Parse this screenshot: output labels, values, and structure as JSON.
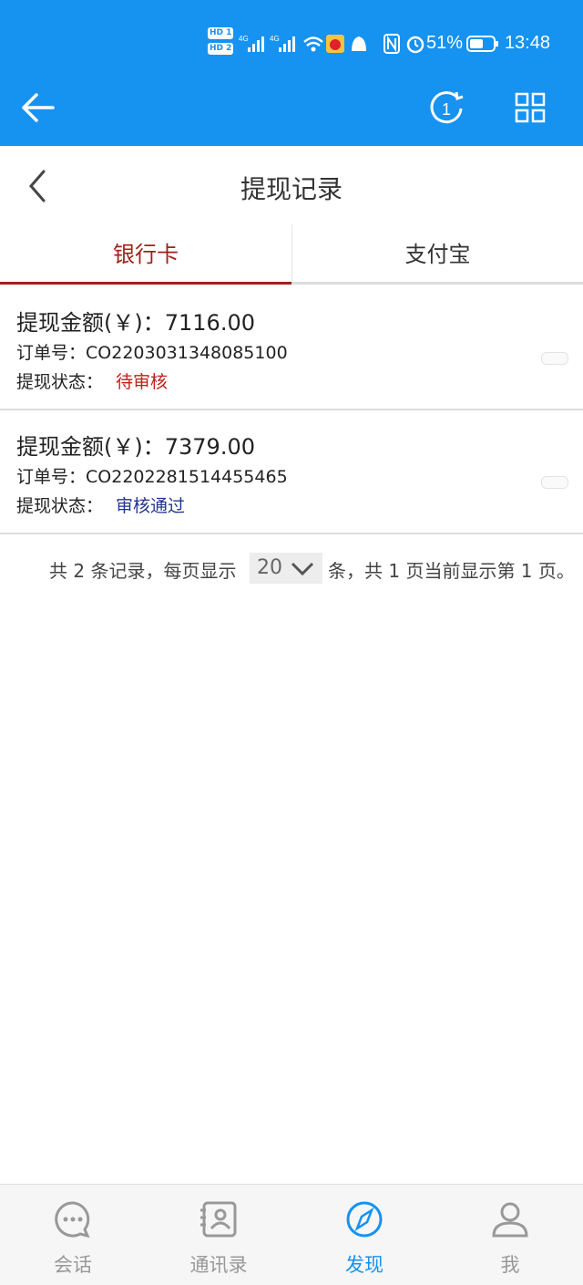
{
  "status_bar": {
    "time": "13:48",
    "battery": "51%",
    "hd1": "HD 1",
    "hd2": "HD 2",
    "net1": "4G",
    "net2": "4G",
    "icons": [
      "signal-icon",
      "wifi-icon",
      "weibo-icon",
      "qq-icon",
      "nfc-icon",
      "alarm-icon",
      "battery-icon"
    ]
  },
  "top_nav": {
    "ops_badge": "1",
    "icons": [
      "back-arrow-icon",
      "ops-circle-icon",
      "grid-icon"
    ],
    "accent": "#1692f0"
  },
  "header": {
    "title": "提现记录"
  },
  "tabs": [
    {
      "label": "银行卡",
      "active": true
    },
    {
      "label": "支付宝",
      "active": false
    }
  ],
  "records": [
    {
      "amount_label": "提现金额(￥)：",
      "amount": "7116.00",
      "order_label": "订单号：",
      "order": "CO2203031348085100",
      "state_label": "提现状态：",
      "state": "待审核",
      "state_color": "#c0201a"
    },
    {
      "amount_label": "提现金额(￥)：",
      "amount": "7379.00",
      "order_label": "订单号：",
      "order": "CO2202281514455465",
      "state_label": "提现状态：",
      "state": "审核通过",
      "state_color": "#23348f"
    }
  ],
  "pager": {
    "prefix": "共 2 条记录，每页显示",
    "page_size": "20",
    "suffix": "条，共 1 页当前显示第 1 页。"
  },
  "bottom_nav": [
    {
      "label": "会话",
      "icon": "chat-icon",
      "active": false
    },
    {
      "label": "通讯录",
      "icon": "contacts-icon",
      "active": false
    },
    {
      "label": "发现",
      "icon": "compass-icon",
      "active": true
    },
    {
      "label": "我",
      "icon": "person-icon",
      "active": false
    }
  ]
}
